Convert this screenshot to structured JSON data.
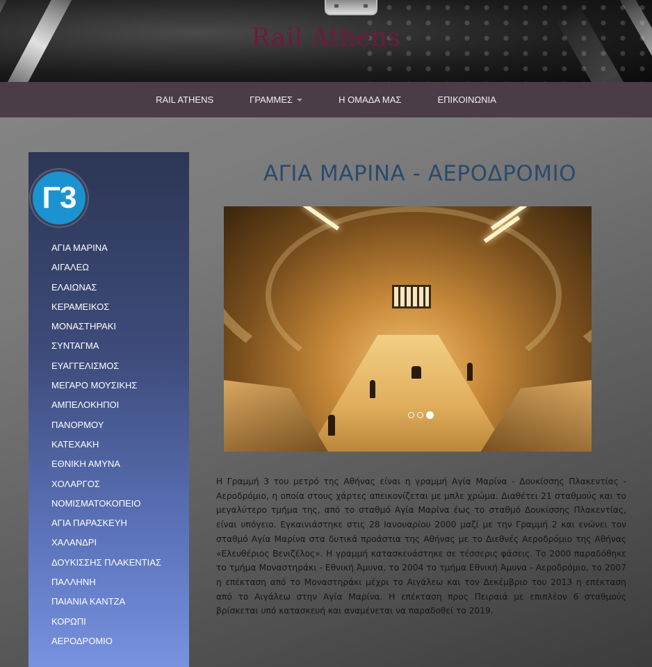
{
  "header": {
    "site_title": "Rail Athens",
    "logo_icon": "train-icon"
  },
  "nav": {
    "items": [
      {
        "label": "RAIL ATHENS"
      },
      {
        "label": "ΓΡΑΜΜΕΣ",
        "dropdown": true
      },
      {
        "label": "Η ΟΜΑΔΑ ΜΑΣ"
      },
      {
        "label": "ΕΠΙΚΟΙΝΩΝΙΑ"
      }
    ]
  },
  "sidebar": {
    "line_badge": "Γ3",
    "line_color": "#1c93d1",
    "stations": [
      "ΑΓΙΑ ΜΑΡΙΝΑ",
      "ΑΙΓΑΛΕΩ",
      "ΕΛΑΙΩΝΑΣ",
      "ΚΕΡΑΜΕΙΚΟΣ",
      "ΜΟΝΑΣΤΗΡΑΚΙ",
      "ΣΥΝΤΑΓΜΑ",
      "ΕΥΑΓΓΕΛΙΣΜΟΣ",
      "ΜΕΓΑΡΟ ΜΟΥΣΙΚΗΣ",
      "ΑΜΠΕΛΟΚΗΠΟΙ",
      "ΠΑΝΟΡΜΟΥ",
      "ΚΑΤΕΧΑΚΗ",
      "ΕΘΝΙΚΗ ΑΜΥΝΑ",
      "ΧΟΛΑΡΓΟΣ",
      "ΝΟΜΙΣΜΑΤΟΚΟΠΕΙΟ",
      "ΑΓΙΑ ΠΑΡΑΣΚΕΥΗ",
      "ΧΑΛΑΝΔΡΙ",
      "ΔΟΥΚΙΣΣΗΣ ΠΛΑΚΕΝΤΙΑΣ",
      "ΠΑΛΛΗΝΗ",
      "ΠΑΙΑΝΙΑ ΚΑΝΤΖΑ",
      "ΚΟΡΩΠΙ",
      "ΑΕΡΟΔΡΟΜΙΟ"
    ]
  },
  "main": {
    "heading": "ΑΓΙΑ ΜΑΡΙΝΑ - ΑΕΡΟΔΡΟΜΙΟ",
    "slider": {
      "slide_count": 3,
      "active_slide": 3
    },
    "description": "Η Γραμμή 3 του μετρό της Αθήνας είναι η γραμμή Αγία Μαρίνα - Δουκίσσης Πλακεντίας - Αεροδρόμιο, η οποία στους χάρτες απεικονίζεται με μπλε χρώμα. Διαθέτει 21 σταθμούς και το μεγαλύτερο τμήμα της, από το σταθμό Αγία Μαρίνα έως το σταθμό Δουκίσσης Πλακεντίας, είναι υπόγειο. Εγκαινιάστηκε στις 28 Ιανουαρίου 2000 μαζί με την Γραμμή 2 και ενώνει τον σταθμό Αγία Μαρίνα στα δυτικά προάστια της Αθήνας με το Διεθνές Αεροδρόμιο της Αθήνας «Ελευθέριος Βενιζέλος». Η γραμμή κατασκευάστηκε σε τέσσερις φάσεις. Το 2000 παραδόθηκε το τμήμα Μοναστηράκι - Εθνική Άμυνα, το 2004 το τμήμα Εθνική Άμυνα - Αεροδρόμιο, το 2007 η επέκταση από το Μοναστηράκι μέχρι το Αιγάλεω και τον Δεκέμβριο του 2013 η επέκταση από το Αιγάλεω στην Αγία Μαρίνα. Η επέκταση προς Πειραιά με επιπλέον 6 σταθμούς βρίσκεται υπό κατασκευή και αναμένεται να παραδοθεί το 2019."
  },
  "colors": {
    "nav_bg": "#4a3d48",
    "title": "#6d1b3c",
    "heading": "#2a4a6e"
  }
}
